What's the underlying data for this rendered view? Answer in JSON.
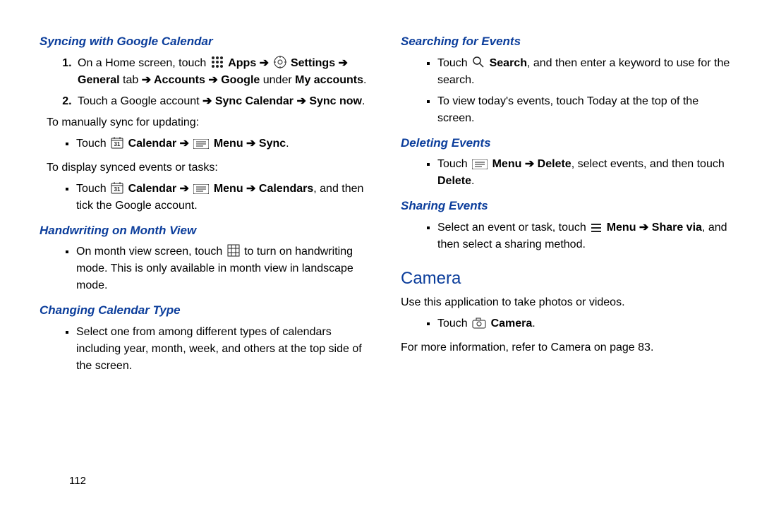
{
  "pageNumber": "112",
  "left": {
    "syncing": {
      "heading": "Syncing with Google Calendar",
      "steps": {
        "s1_pre": "On a Home screen, touch ",
        "s1_apps": "Apps",
        "s1_settings": "Settings",
        "s1_general": "General",
        "s1_tab": " tab",
        "s1_accounts": "Accounts",
        "s1_google": "Google",
        "s1_under": " under ",
        "s1_myaccounts": "My accounts",
        "s1_period": ".",
        "s2_pre": "Touch a Google account",
        "s2_sync_cal": "Sync Calendar",
        "s2_sync_now": "Sync now",
        "s2_period": "."
      },
      "manual_intro": "To manually sync for updating:",
      "manual_bullet": {
        "touch": "Touch ",
        "calendar": "Calendar",
        "menu": "Menu",
        "sync": "Sync",
        "period": "."
      },
      "display_intro": "To display synced events or tasks:",
      "display_bullet": {
        "touch": "Touch ",
        "calendar": "Calendar",
        "menu": "Menu",
        "calendars": "Calendars",
        "tail": ", and then tick the Google account."
      }
    },
    "handwriting": {
      "heading": "Handwriting on Month View",
      "bullet": {
        "pre": "On month view screen, touch ",
        "post": " to turn on handwriting mode. This is only available in month view in landscape mode."
      }
    },
    "changing": {
      "heading": "Changing Calendar Type",
      "bullet": "Select one from among different types of calendars including year, month, week, and others at the top side of the screen."
    }
  },
  "right": {
    "searching": {
      "heading": "Searching for Events",
      "b1_touch": "Touch ",
      "b1_search": "Search",
      "b1_tail": ", and then enter a keyword to use for the search.",
      "b2": "To view today's events, touch Today at the top of the screen."
    },
    "deleting": {
      "heading": "Deleting Events",
      "touch": "Touch ",
      "menu": "Menu",
      "delete": "Delete",
      "mid": ", select events, and then touch ",
      "delete2": "Delete",
      "period": "."
    },
    "sharing": {
      "heading": "Sharing Events",
      "pre": "Select an event or task, touch ",
      "menu": "Menu",
      "share": "Share via",
      "tail": ", and then select a sharing method."
    },
    "camera": {
      "heading": "Camera",
      "intro": "Use this application to take photos or videos.",
      "bullet_touch": "Touch ",
      "bullet_camera": "Camera",
      "bullet_period": ".",
      "more": "For more information, refer to ",
      "xref": "Camera",
      "onpage": " on page 83."
    }
  }
}
